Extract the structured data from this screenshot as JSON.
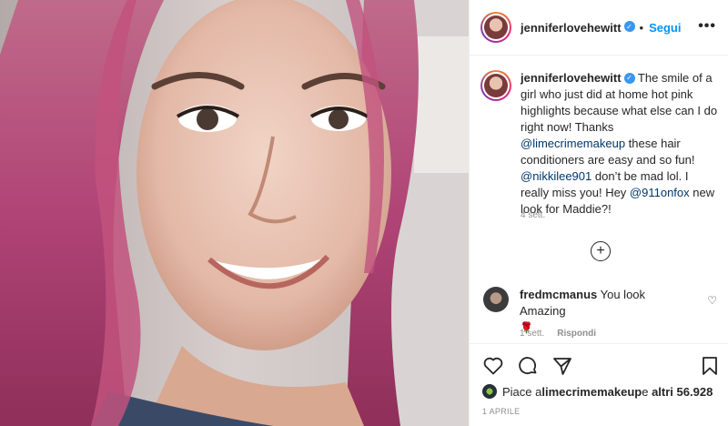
{
  "post": {
    "username": "jenniferlovehewitt",
    "follow_label": "Segui",
    "more_label": "•••",
    "separator": "•"
  },
  "caption": {
    "username": "jenniferlovehewitt",
    "text_1": " The smile of a girl who just did at home hot pink highlights because what else can I do right now! Thanks ",
    "mention_1": "@limecrimemakeup",
    "text_2": " these hair conditioners are easy and so fun! ",
    "mention_2": "@nikkilee901",
    "text_3": " don’t be mad lol. I really miss you! Hey ",
    "mention_3": "@911onfox",
    "text_4": " new look for Maddie?!",
    "time": "4 sett."
  },
  "load_more": {
    "icon": "plus-circle-icon"
  },
  "comment": {
    "username": "fredmcmanus",
    "text": " You look Amazing",
    "emoji": "🌹",
    "time": "1 sett.",
    "reply_label": "Rispondi"
  },
  "likes": {
    "prefix": "Piace a ",
    "user": "limecrimemakeup",
    "middle": " e ",
    "others": "altri 56.928"
  },
  "date": "1 APRILE",
  "icons": [
    "heart-icon",
    "comment-icon",
    "share-icon",
    "bookmark-icon"
  ]
}
